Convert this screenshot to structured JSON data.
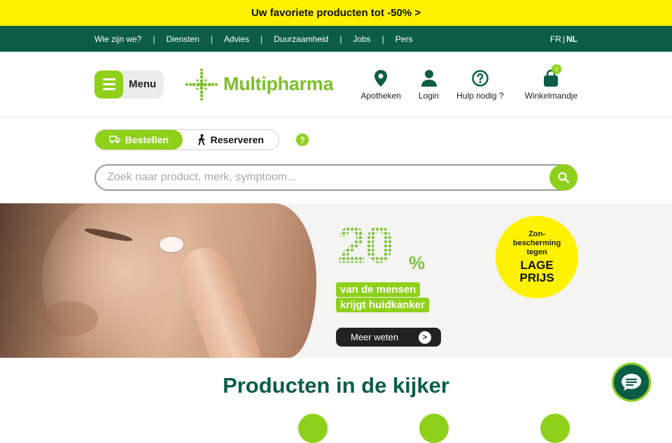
{
  "promo": {
    "text": "Uw favoriete producten tot -50% >"
  },
  "topnav": {
    "links": [
      "Wie zijn we?",
      "Diensten",
      "Advies",
      "Duurzaamheid",
      "Jobs",
      "Pers"
    ],
    "separator": "|",
    "lang": {
      "fr": "FR",
      "divider": "|",
      "nl": "NL"
    }
  },
  "header": {
    "menu_label": "Menu",
    "logo_text": "Multipharma",
    "actions": [
      {
        "label": "Apotheken",
        "icon": "location-pin-icon"
      },
      {
        "label": "Login",
        "icon": "user-icon"
      },
      {
        "label": "Hulp nodig ?",
        "icon": "help-circle-icon"
      },
      {
        "label": "Winkelmandje",
        "icon": "shopping-bag-icon",
        "badge": "0"
      }
    ]
  },
  "search": {
    "toggle": {
      "order": "Bestellen",
      "reserve": "Reserveren"
    },
    "help": "?",
    "placeholder": "Zoek naar product, merk, symptoom..."
  },
  "hero": {
    "stat_number": "20",
    "stat_percent": "%",
    "line1": "van de mensen",
    "line2": "krijgt huidkanker",
    "cta": "Meer weten",
    "cta_arrow": ">",
    "badge_line1": "Zon-",
    "badge_line2": "bescherming",
    "badge_line3": "tegen",
    "badge_big1": "LAGE",
    "badge_big2": "PRIJS"
  },
  "section": {
    "title": "Producten in de kijker"
  },
  "colors": {
    "accent_green": "#8fd01a",
    "dark_green": "#0b5e45",
    "promo_yellow": "#fff200"
  }
}
